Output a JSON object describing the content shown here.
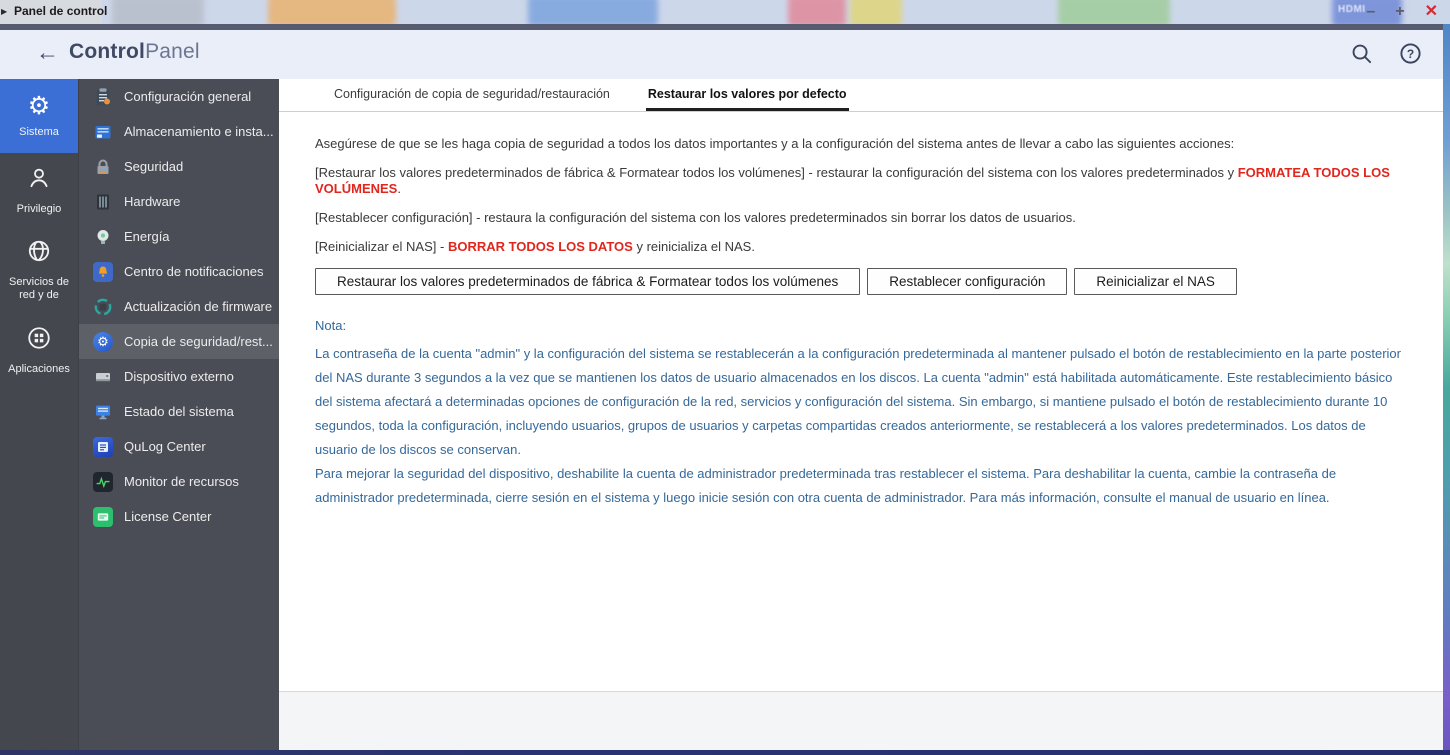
{
  "window": {
    "title": "Panel de control",
    "minimize": "–",
    "maximize": "+",
    "close": "✕",
    "background_label": "HDMI"
  },
  "header": {
    "back": "←",
    "title_bold": "Control",
    "title_light": "Panel"
  },
  "sidebar": {
    "items": [
      {
        "label": "Sistema",
        "icon": "gear-icon",
        "selected": true
      },
      {
        "label": "Privilegio",
        "icon": "user-icon",
        "selected": false
      },
      {
        "label": "Servicios de red y de",
        "icon": "globe-icon",
        "selected": false
      },
      {
        "label": "Aplicaciones",
        "icon": "apps-icon",
        "selected": false
      }
    ]
  },
  "menu": {
    "items": [
      {
        "label": "Configuración general",
        "icon": "clipboard-icon",
        "selected": false
      },
      {
        "label": "Almacenamiento e insta...",
        "icon": "storage-icon",
        "selected": false
      },
      {
        "label": "Seguridad",
        "icon": "lock-icon",
        "selected": false
      },
      {
        "label": "Hardware",
        "icon": "server-icon",
        "selected": false
      },
      {
        "label": "Energía",
        "icon": "bulb-icon",
        "selected": false
      },
      {
        "label": "Centro de notificaciones",
        "icon": "bell-icon",
        "selected": false
      },
      {
        "label": "Actualización de firmware",
        "icon": "firmware-update-icon",
        "selected": false
      },
      {
        "label": "Copia de seguridad/rest...",
        "icon": "backup-gear-icon",
        "selected": true
      },
      {
        "label": "Dispositivo externo",
        "icon": "external-drive-icon",
        "selected": false
      },
      {
        "label": "Estado del sistema",
        "icon": "system-status-icon",
        "selected": false
      },
      {
        "label": "QuLog Center",
        "icon": "qulog-icon",
        "selected": false
      },
      {
        "label": "Monitor de recursos",
        "icon": "resource-graph-icon",
        "selected": false
      },
      {
        "label": "License Center",
        "icon": "license-icon",
        "selected": false
      }
    ]
  },
  "tabs": [
    {
      "label": "Configuración de copia de seguridad/restauración",
      "active": false
    },
    {
      "label": "Restaurar los valores por defecto",
      "active": true
    }
  ],
  "content": {
    "intro": "Asegúrese de que se les haga copia de seguridad a todos los datos importantes y a la configuración del sistema antes de llevar a cabo las siguientes acciones:",
    "action1_prefix": "[Restaurar los valores predeterminados de fábrica & Formatear todos los volúmenes] - restaurar la configuración del sistema con los valores predeterminados y ",
    "action1_warning": "FORMATEA TODOS LOS VOLÚMENES",
    "action1_suffix": ".",
    "action2": "[Restablecer configuración] - restaura la configuración del sistema con los valores predeterminados sin borrar los datos de usuarios.",
    "action3_prefix": "[Reinicializar el NAS] - ",
    "action3_warning": "BORRAR TODOS LOS DATOS",
    "action3_suffix": " y reinicializa el NAS.",
    "buttons": [
      "Restaurar los valores predeterminados de fábrica & Formatear todos los volúmenes",
      "Restablecer configuración",
      "Reinicializar el NAS"
    ],
    "note_title": "Nota:",
    "note_p1": "La contraseña de la cuenta \"admin\" y la configuración del sistema se restablecerán a la configuración predeterminada al mantener pulsado el botón de restablecimiento en la parte posterior del NAS durante 3 segundos a la vez que se mantienen los datos de usuario almacenados en los discos. La cuenta \"admin\" está habilitada automáticamente. Este restablecimiento básico del sistema afectará a determinadas opciones de configuración de la red, servicios y configuración del sistema. Sin embargo, si mantiene pulsado el botón de restablecimiento durante 10 segundos, toda la configuración, incluyendo usuarios, grupos de usuarios y carpetas compartidas creados anteriormente, se restablecerá a los valores predeterminados. Los datos de usuario de los discos se conservan.",
    "note_p2": "Para mejorar la seguridad del dispositivo, deshabilite la cuenta de administrador predeterminada tras restablecer el sistema. Para deshabilitar la cuenta, cambie la contraseña de administrador predeterminada, cierre sesión en el sistema y luego inicie sesión con otra cuenta de administrador. Para más información, consulte el manual de usuario en línea."
  },
  "colors": {
    "sidebar_selected_blue": "#3b6fd6",
    "warning_red": "#e0261d",
    "note_blue": "#35689a",
    "menu_selected": "#5e6068",
    "header_bg": "#e9eef9"
  }
}
